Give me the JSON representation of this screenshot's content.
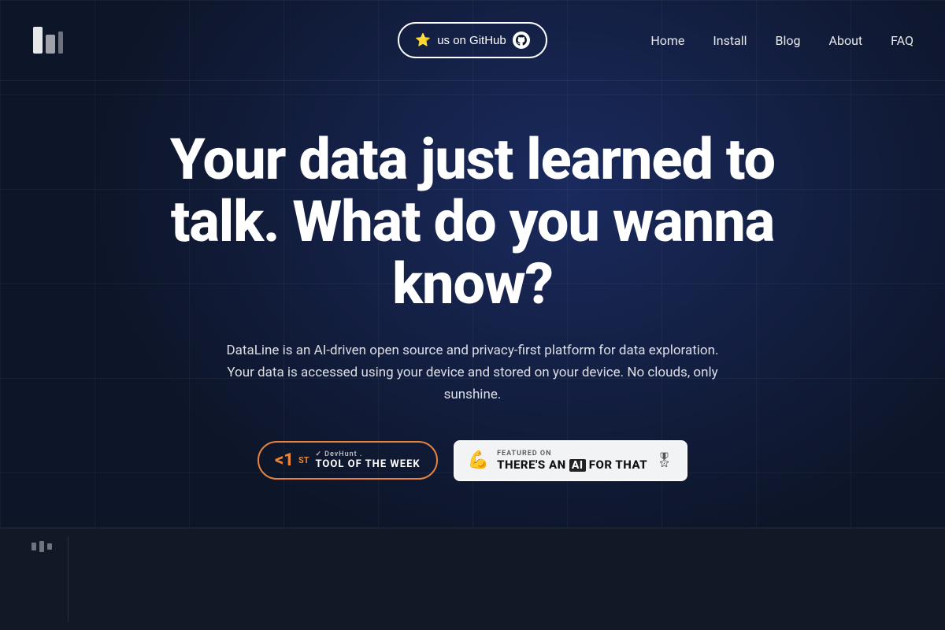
{
  "nav": {
    "github_btn_label": "us on GitHub",
    "github_star": "⭐",
    "links": [
      {
        "label": "Home",
        "name": "home"
      },
      {
        "label": "Install",
        "name": "install"
      },
      {
        "label": "Blog",
        "name": "blog"
      },
      {
        "label": "About",
        "name": "about"
      },
      {
        "label": "FAQ",
        "name": "faq"
      }
    ]
  },
  "hero": {
    "title": "Your data just learned to talk. What do you wanna know?",
    "subtitle": "DataLine is an AI-driven open source and privacy-first platform for data exploration. Your data is accessed using your device and stored on your device. No clouds, only sunshine.",
    "badge_devhunt": {
      "number": "<1",
      "sup": "ST",
      "brand": "✓ DevHunt .",
      "label": "TOOL OF THE WEEK"
    },
    "badge_aithat": {
      "arm_emoji": "💪",
      "featured_label": "FEATURED ON",
      "name_prefix": "THERE'S AN",
      "name_highlight": "AI",
      "name_suffix": "FOR THAT"
    }
  },
  "colors": {
    "bg": "#0d1528",
    "nav_border": "rgba(255,255,255,0.07)",
    "github_border": "#ffffff",
    "devhunt_border": "#e8833a",
    "accent": "#e8833a"
  }
}
